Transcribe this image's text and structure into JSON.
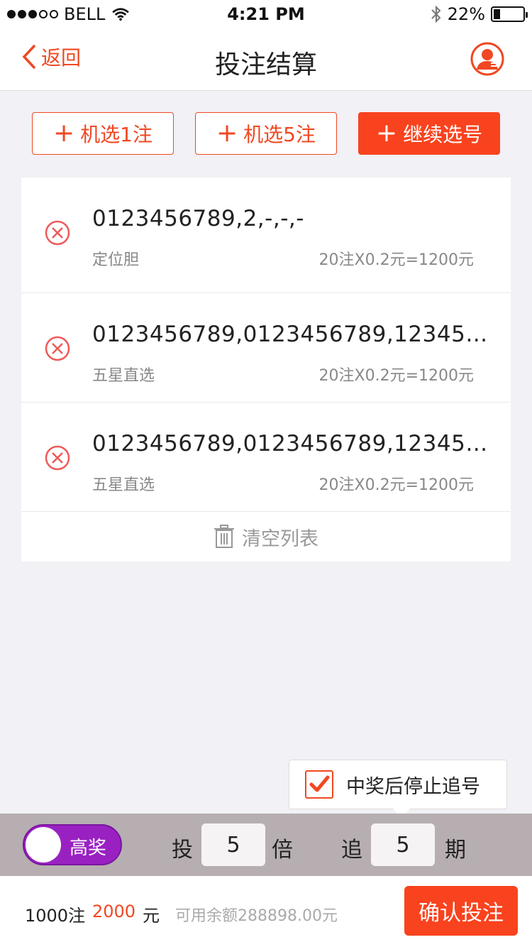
{
  "status_bar": {
    "carrier": "BELL",
    "time": "4:21 PM",
    "battery": "22%",
    "battery_level": 0.22
  },
  "nav": {
    "back_label": "返回",
    "title": "投注结算"
  },
  "actions": {
    "random1": "机选1注",
    "random5": "机选5注",
    "continue": "继续选号"
  },
  "bets": [
    {
      "numbers": "0123456789,2,-,-,-",
      "type": "定位胆",
      "amount": "20注X0.2元=1200元"
    },
    {
      "numbers": "0123456789,0123456789,12345…",
      "type": "五星直选",
      "amount": "20注X0.2元=1200元"
    },
    {
      "numbers": "0123456789,0123456789,12345…",
      "type": "五星直选",
      "amount": "20注X0.2元=1200元"
    }
  ],
  "clear_list": "清空列表",
  "stop_tip": {
    "label": "中奖后停止追号",
    "checked": true
  },
  "controls": {
    "toggle_label": "高奖",
    "multiply_prefix": "投",
    "multiply_value": "5",
    "multiply_suffix": "倍",
    "chase_prefix": "追",
    "chase_value": "5",
    "chase_suffix": "期"
  },
  "footer": {
    "count": "1000注",
    "money": "2000",
    "unit": "元",
    "balance": "可用余额288898.00元",
    "confirm": "确认投注"
  },
  "colors": {
    "accent": "#f9431e",
    "toggle": "#9a21c1",
    "control_bar": "#b6aeb0"
  }
}
